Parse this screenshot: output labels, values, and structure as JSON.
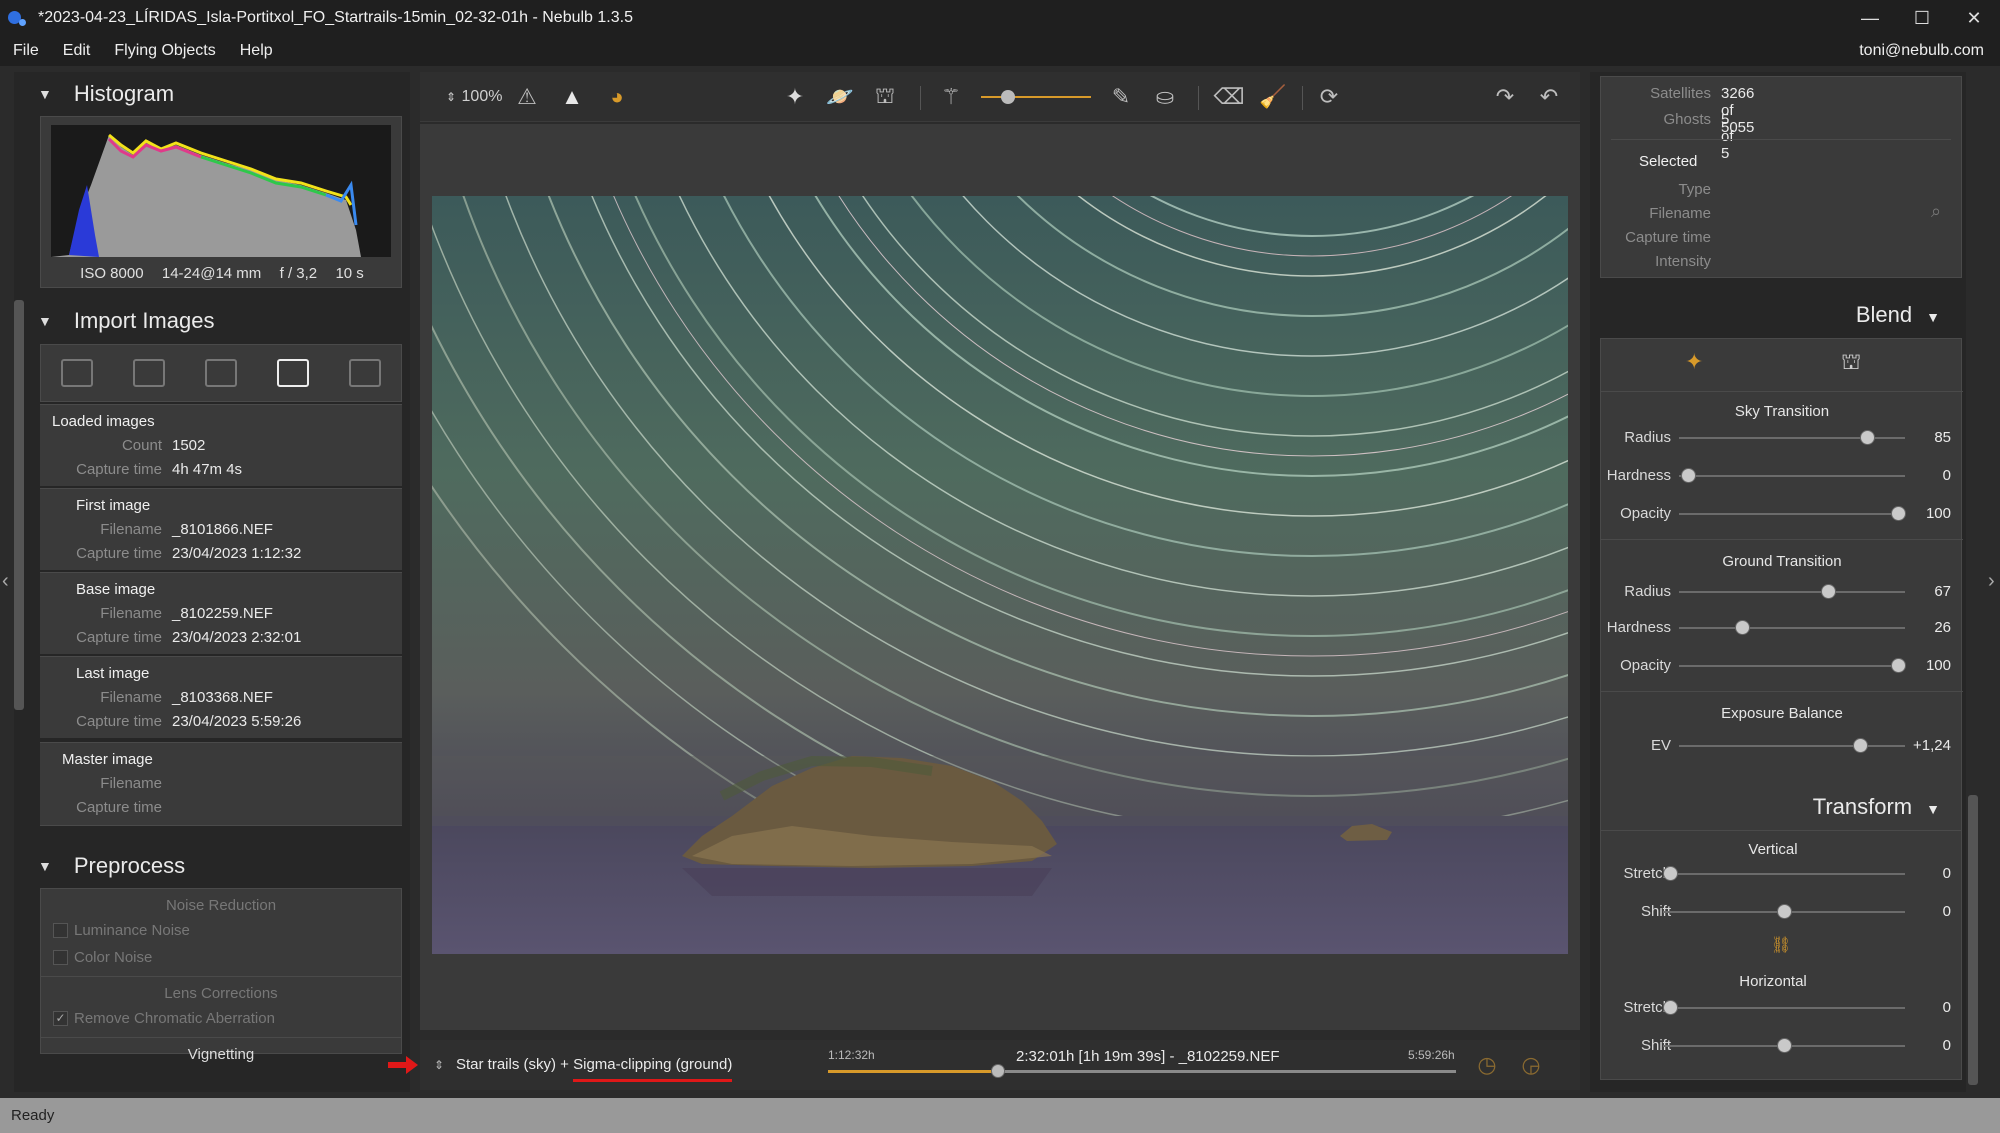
{
  "window": {
    "title": "*2023-04-23_LÍRIDAS_Isla-Portitxol_FO_Startrails-15min_02-32-01h - Nebulb 1.3.5",
    "min": "—",
    "max": "☐",
    "close": "✕"
  },
  "menu": {
    "items": [
      "File",
      "Edit",
      "Flying Objects",
      "Help"
    ],
    "user": "toni@nebulb.com"
  },
  "histogram": {
    "title": "Histogram",
    "iso": "ISO 8000",
    "lens": "14-24@14 mm",
    "aperture": "f / 3,2",
    "exposure": "10 s"
  },
  "import": {
    "title": "Import Images",
    "loaded": {
      "title": "Loaded images",
      "count_label": "Count",
      "count": "1502",
      "capture_label": "Capture time",
      "capture": "4h 47m 4s"
    },
    "first": {
      "title": "First image",
      "filename_label": "Filename",
      "filename": "_8101866.NEF",
      "capture_label": "Capture time",
      "capture": "23/04/2023 1:12:32"
    },
    "base": {
      "title": "Base image",
      "filename_label": "Filename",
      "filename": "_8102259.NEF",
      "capture_label": "Capture time",
      "capture": "23/04/2023 2:32:01"
    },
    "last": {
      "title": "Last image",
      "filename_label": "Filename",
      "filename": "_8103368.NEF",
      "capture_label": "Capture time",
      "capture": "23/04/2023 5:59:26"
    },
    "master": {
      "title": "Master image",
      "filename_label": "Filename",
      "capture_label": "Capture time"
    }
  },
  "preprocess": {
    "title": "Preprocess",
    "noise_title": "Noise Reduction",
    "luminance": "Luminance Noise",
    "color": "Color Noise",
    "lens_title": "Lens Corrections",
    "chromatic": "Remove Chromatic Aberration",
    "vignetting": "Vignetting"
  },
  "toolbar": {
    "zoom": "100%"
  },
  "bottom": {
    "mode_prefix": "Star trails (sky) + ",
    "mode_highlight": "Sigma-clipping (ground)",
    "start": "1:12:32h",
    "current": "2:32:01h [1h 19m 39s] - _8102259.NEF",
    "end": "5:59:26h",
    "position": 0.27
  },
  "flying": {
    "satellites_label": "Satellites",
    "satellites": "3266 of 5055",
    "ghosts_label": "Ghosts",
    "ghosts": "5 of 5",
    "selected": "Selected",
    "type_label": "Type",
    "filename_label": "Filename",
    "capture_label": "Capture time",
    "intensity_label": "Intensity"
  },
  "blend": {
    "title": "Blend",
    "sky_title": "Sky Transition",
    "sky": [
      {
        "label": "Radius",
        "value": "85",
        "pos": 0.83
      },
      {
        "label": "Hardness",
        "value": "0",
        "pos": 0.04
      },
      {
        "label": "Opacity",
        "value": "100",
        "pos": 0.97
      }
    ],
    "ground_title": "Ground Transition",
    "ground": [
      {
        "label": "Radius",
        "value": "67",
        "pos": 0.66
      },
      {
        "label": "Hardness",
        "value": "26",
        "pos": 0.28
      },
      {
        "label": "Opacity",
        "value": "100",
        "pos": 0.97
      }
    ],
    "exposure_title": "Exposure Balance",
    "ev": {
      "label": "EV",
      "value": "+1,24",
      "pos": 0.8
    }
  },
  "transform": {
    "title": "Transform",
    "vertical_title": "Vertical",
    "vertical": [
      {
        "label": "Stretch",
        "value": "0",
        "pos": 0.03
      },
      {
        "label": "Shift",
        "value": "0",
        "pos": 0.5
      }
    ],
    "horizontal_title": "Horizontal",
    "horizontal": [
      {
        "label": "Stretch",
        "value": "0",
        "pos": 0.03
      },
      {
        "label": "Shift",
        "value": "0",
        "pos": 0.5
      }
    ]
  },
  "status": "Ready",
  "colors": {
    "accent": "#d89a2a",
    "highlight_underline": "#e01818"
  }
}
